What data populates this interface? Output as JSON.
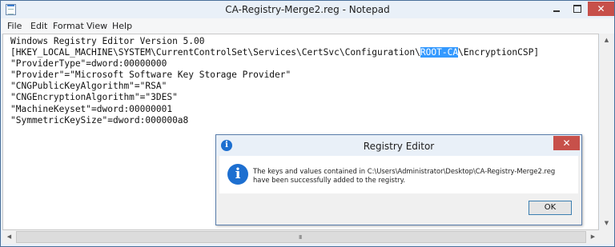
{
  "window": {
    "title": "CA-Registry-Merge2.reg - Notepad",
    "app_icon": "notepad-icon",
    "close_glyph": "✕"
  },
  "menu": [
    "File",
    "Edit",
    "Format",
    "View",
    "Help"
  ],
  "document": {
    "lines": [
      "Windows Registry Editor Version 5.00",
      "",
      "[HKEY_LOCAL_MACHINE\\SYSTEM\\CurrentControlSet\\Services\\CertSvc\\Configuration\\ROOT-CA\\EncryptionCSP]",
      "\"ProviderType\"=dword:00000000",
      "\"Provider\"=\"Microsoft Software Key Storage Provider\"",
      "\"CNGPublicKeyAlgorithm\"=\"RSA\"",
      "\"CNGEncryptionAlgorithm\"=\"3DES\"",
      "\"MachineKeyset\"=dword:00000001",
      "\"SymmetricKeySize\"=dword:000000a8"
    ],
    "key_prefix": "[HKEY_LOCAL_MACHINE\\SYSTEM\\CurrentControlSet\\Services\\CertSvc\\Configuration\\",
    "selected_text": "ROOT-CA",
    "key_suffix": "\\EncryptionCSP]",
    "selection_color": "#3399ff"
  },
  "scrollbar": {
    "grip": "III"
  },
  "dialog": {
    "title": "Registry Editor",
    "icon": "info-icon",
    "icon_glyph": "i",
    "message_line1": "The keys and values contained in C:\\Users\\Administrator\\Desktop\\CA-Registry-Merge2.reg",
    "message_line2": "have been successfully added to the registry.",
    "ok_label": "OK",
    "close_glyph": "✕"
  },
  "colors": {
    "close_button": "#c7504a",
    "info_blue": "#1d6fd0",
    "title_bar": "#e9f0f8"
  }
}
